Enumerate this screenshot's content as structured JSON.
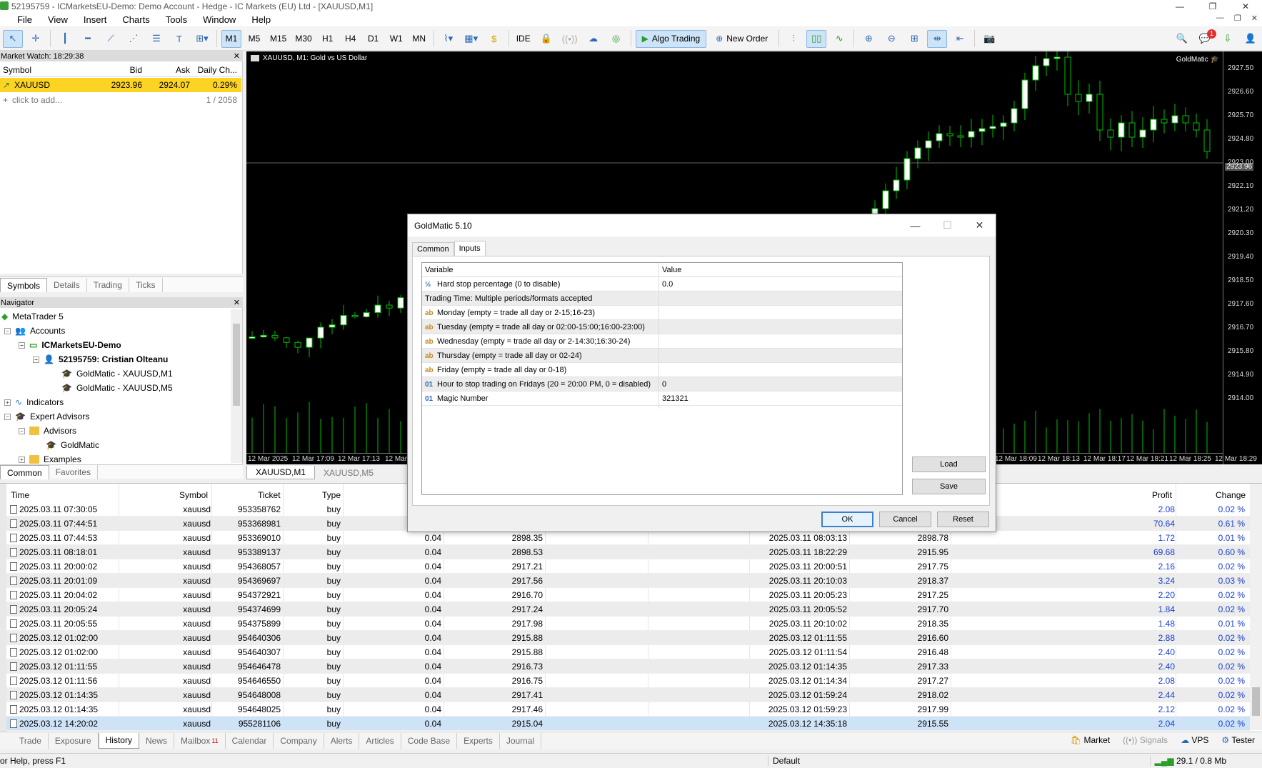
{
  "window": {
    "title": "52195759 - ICMarketsEU-Demo: Demo Account - Hedge - IC Markets (EU) Ltd - [XAUUSD,M1]"
  },
  "menu": [
    "File",
    "View",
    "Insert",
    "Charts",
    "Tools",
    "Window",
    "Help"
  ],
  "toolbar": {
    "timeframes": [
      "M1",
      "M5",
      "M15",
      "M30",
      "H1",
      "H4",
      "D1",
      "W1",
      "MN"
    ],
    "active_timeframe": "M1",
    "ide_label": "IDE",
    "algo_trading_label": "Algo Trading",
    "new_order_label": "New Order",
    "notification_count": "1"
  },
  "market_watch": {
    "title": "Market Watch: 18:29:38",
    "columns": [
      "Symbol",
      "Bid",
      "Ask",
      "Daily Ch..."
    ],
    "rows": [
      {
        "symbol": "XAUUSD",
        "bid": "2923.96",
        "ask": "2924.07",
        "daily_change": "0.29%"
      }
    ],
    "add_placeholder": "click to add...",
    "count": "1 / 2058",
    "tabs": [
      "Symbols",
      "Details",
      "Trading",
      "Ticks"
    ]
  },
  "navigator": {
    "title": "Navigator",
    "items": [
      {
        "label": "MetaTrader 5",
        "level": 0
      },
      {
        "label": "Accounts",
        "level": 1
      },
      {
        "label": "ICMarketsEU-Demo",
        "level": 2
      },
      {
        "label": "52195759: Cristian Olteanu",
        "level": 3
      },
      {
        "label": "GoldMatic - XAUUSD,M1",
        "level": 4
      },
      {
        "label": "GoldMatic - XAUUSD,M5",
        "level": 4
      },
      {
        "label": "Indicators",
        "level": 1
      },
      {
        "label": "Expert Advisors",
        "level": 1
      },
      {
        "label": "Advisors",
        "level": 2
      },
      {
        "label": "GoldMatic",
        "level": 3
      },
      {
        "label": "Examples",
        "level": 2
      }
    ],
    "tabs": [
      "Common",
      "Favorites"
    ]
  },
  "chart": {
    "title": "XAUUSD, M1:  Gold vs US Dollar",
    "ea_label": "GoldMatic",
    "current_price": "2923.96",
    "price_labels": [
      "2927.50",
      "2926.60",
      "2925.70",
      "2924.80",
      "2923.96",
      "2923.00",
      "2922.10",
      "2921.20",
      "2920.30",
      "2919.40",
      "2918.50",
      "2917.60",
      "2916.70",
      "2915.80",
      "2914.90",
      "2914.00"
    ],
    "time_labels": [
      "12 Mar 2025",
      "12 Mar 17:09",
      "12 Mar 17:13",
      "12 Mar",
      "12 Mar 18:09",
      "12 Mar 18:13",
      "12 Mar 18:17",
      "12 Mar 18:21",
      "12 Mar 18:25",
      "12 Mar 18:29"
    ],
    "tabs": [
      "XAUUSD,M1",
      "XAUUSD,M5"
    ]
  },
  "history": {
    "columns": [
      "Time",
      "Symbol",
      "Ticket",
      "Type",
      "Profit",
      "Change"
    ],
    "rows": [
      {
        "time": "2025.03.11 07:30:05",
        "symbol": "xauusd",
        "ticket": "953358762",
        "type": "buy",
        "volume": "",
        "open_price": "",
        "close_time": "",
        "close_price": "",
        "profit": "2.08",
        "change": "0.02 %"
      },
      {
        "time": "2025.03.11 07:44:51",
        "symbol": "xauusd",
        "ticket": "953368981",
        "type": "buy",
        "volume": "",
        "open_price": "",
        "close_time": "",
        "close_price": "",
        "profit": "70.64",
        "change": "0.61 %"
      },
      {
        "time": "2025.03.11 07:44:53",
        "symbol": "xauusd",
        "ticket": "953369010",
        "type": "buy",
        "volume": "0.04",
        "open_price": "2898.35",
        "close_time": "2025.03.11 08:03:13",
        "close_price": "2898.78",
        "profit": "1.72",
        "change": "0.01 %"
      },
      {
        "time": "2025.03.11 08:18:01",
        "symbol": "xauusd",
        "ticket": "953389137",
        "type": "buy",
        "volume": "0.04",
        "open_price": "2898.53",
        "close_time": "2025.03.11 18:22:29",
        "close_price": "2915.95",
        "profit": "69.68",
        "change": "0.60 %"
      },
      {
        "time": "2025.03.11 20:00:02",
        "symbol": "xauusd",
        "ticket": "954368057",
        "type": "buy",
        "volume": "0.04",
        "open_price": "2917.21",
        "close_time": "2025.03.11 20:00:51",
        "close_price": "2917.75",
        "profit": "2.16",
        "change": "0.02 %"
      },
      {
        "time": "2025.03.11 20:01:09",
        "symbol": "xauusd",
        "ticket": "954369697",
        "type": "buy",
        "volume": "0.04",
        "open_price": "2917.56",
        "close_time": "2025.03.11 20:10:03",
        "close_price": "2918.37",
        "profit": "3.24",
        "change": "0.03 %"
      },
      {
        "time": "2025.03.11 20:04:02",
        "symbol": "xauusd",
        "ticket": "954372921",
        "type": "buy",
        "volume": "0.04",
        "open_price": "2916.70",
        "close_time": "2025.03.11 20:05:23",
        "close_price": "2917.25",
        "profit": "2.20",
        "change": "0.02 %"
      },
      {
        "time": "2025.03.11 20:05:24",
        "symbol": "xauusd",
        "ticket": "954374699",
        "type": "buy",
        "volume": "0.04",
        "open_price": "2917.24",
        "close_time": "2025.03.11 20:05:52",
        "close_price": "2917.70",
        "profit": "1.84",
        "change": "0.02 %"
      },
      {
        "time": "2025.03.11 20:05:55",
        "symbol": "xauusd",
        "ticket": "954375899",
        "type": "buy",
        "volume": "0.04",
        "open_price": "2917.98",
        "close_time": "2025.03.11 20:10:02",
        "close_price": "2918.35",
        "profit": "1.48",
        "change": "0.01 %"
      },
      {
        "time": "2025.03.12 01:02:00",
        "symbol": "xauusd",
        "ticket": "954640306",
        "type": "buy",
        "volume": "0.04",
        "open_price": "2915.88",
        "close_time": "2025.03.12 01:11:55",
        "close_price": "2916.60",
        "profit": "2.88",
        "change": "0.02 %"
      },
      {
        "time": "2025.03.12 01:02:00",
        "symbol": "xauusd",
        "ticket": "954640307",
        "type": "buy",
        "volume": "0.04",
        "open_price": "2915.88",
        "close_time": "2025.03.12 01:11:54",
        "close_price": "2916.48",
        "profit": "2.40",
        "change": "0.02 %"
      },
      {
        "time": "2025.03.12 01:11:55",
        "symbol": "xauusd",
        "ticket": "954646478",
        "type": "buy",
        "volume": "0.04",
        "open_price": "2916.73",
        "close_time": "2025.03.12 01:14:35",
        "close_price": "2917.33",
        "profit": "2.40",
        "change": "0.02 %"
      },
      {
        "time": "2025.03.12 01:11:56",
        "symbol": "xauusd",
        "ticket": "954646550",
        "type": "buy",
        "volume": "0.04",
        "open_price": "2916.75",
        "close_time": "2025.03.12 01:14:34",
        "close_price": "2917.27",
        "profit": "2.08",
        "change": "0.02 %"
      },
      {
        "time": "2025.03.12 01:14:35",
        "symbol": "xauusd",
        "ticket": "954648008",
        "type": "buy",
        "volume": "0.04",
        "open_price": "2917.41",
        "close_time": "2025.03.12 01:59:24",
        "close_price": "2918.02",
        "profit": "2.44",
        "change": "0.02 %"
      },
      {
        "time": "2025.03.12 01:14:35",
        "symbol": "xauusd",
        "ticket": "954648025",
        "type": "buy",
        "volume": "0.04",
        "open_price": "2917.46",
        "close_time": "2025.03.12 01:59:23",
        "close_price": "2917.99",
        "profit": "2.12",
        "change": "0.02 %"
      },
      {
        "time": "2025.03.12 14:20:02",
        "symbol": "xauusd",
        "ticket": "955281106",
        "type": "buy",
        "volume": "0.04",
        "open_price": "2915.04",
        "close_time": "2025.03.12 14:35:18",
        "close_price": "2915.55",
        "profit": "2.04",
        "change": "0.02 %"
      }
    ]
  },
  "bottom_tabs": [
    "Trade",
    "Exposure",
    "History",
    "News",
    "Mailbox",
    "Calendar",
    "Company",
    "Alerts",
    "Articles",
    "Code Base",
    "Experts",
    "Journal"
  ],
  "active_bottom_tab": "History",
  "mailbox_count": "11",
  "bottom_right": {
    "market": "Market",
    "signals": "Signals",
    "vps": "VPS",
    "tester": "Tester"
  },
  "statusbar": {
    "help": "or Help, press F1",
    "profile": "Default",
    "traffic": "29.1 / 0.8 Mb"
  },
  "dialog": {
    "title": "GoldMatic 5.10",
    "tabs": [
      "Common",
      "Inputs"
    ],
    "active_tab": "Inputs",
    "columns": [
      "Variable",
      "Value"
    ],
    "rows": [
      {
        "icon": "½",
        "variable": "Hard stop percentage (0 to disable)",
        "value": "0.0"
      },
      {
        "icon": "",
        "variable": "Trading Time: Multiple periods/formats accepted",
        "value": ""
      },
      {
        "icon": "ab",
        "variable": "Monday (empty = trade all day or 2-15;16-23)",
        "value": ""
      },
      {
        "icon": "ab",
        "variable": "Tuesday (empty = trade all day or 02:00-15:00;16:00-23:00)",
        "value": ""
      },
      {
        "icon": "ab",
        "variable": "Wednesday (empty = trade all day or 2-14:30;16:30-24)",
        "value": ""
      },
      {
        "icon": "ab",
        "variable": "Thursday (empty = trade all day or 02-24)",
        "value": ""
      },
      {
        "icon": "ab",
        "variable": "Friday (empty = trade all day or 0-18)",
        "value": ""
      },
      {
        "icon": "01",
        "variable": "Hour to stop trading on Fridays (20 = 20:00 PM, 0 = disabled)",
        "value": "0"
      },
      {
        "icon": "01",
        "variable": "Magic Number",
        "value": "321321"
      }
    ],
    "buttons": {
      "load": "Load",
      "save": "Save",
      "ok": "OK",
      "cancel": "Cancel",
      "reset": "Reset"
    }
  },
  "colors": {
    "selected_symbol": "#fdd324",
    "bull_candle": "#ffffff",
    "bear_candle": "#00c000",
    "profit_text": "#1a3fd0"
  }
}
